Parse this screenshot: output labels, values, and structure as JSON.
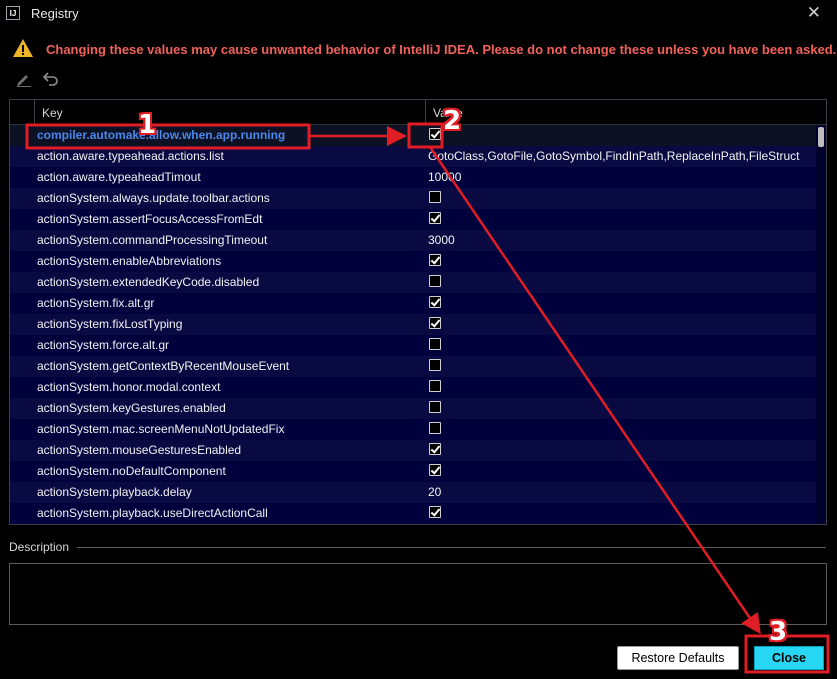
{
  "window": {
    "title": "Registry",
    "app_icon_text": "IJ"
  },
  "warning": {
    "text": "Changing these values may cause unwanted behavior of IntelliJ IDEA. Please do not change these unless you have been asked."
  },
  "table": {
    "headers": {
      "key": "Key",
      "value": "Value"
    },
    "rows": [
      {
        "key": "compiler.automake.allow.when.app.running",
        "type": "bool",
        "checked": true,
        "selected": true
      },
      {
        "key": "action.aware.typeahead.actions.list",
        "type": "text",
        "value": "GotoClass,GotoFile,GotoSymbol,FindInPath,ReplaceInPath,FileStruct"
      },
      {
        "key": "action.aware.typeaheadTimout",
        "type": "text",
        "value": "10000"
      },
      {
        "key": "actionSystem.always.update.toolbar.actions",
        "type": "bool",
        "checked": false
      },
      {
        "key": "actionSystem.assertFocusAccessFromEdt",
        "type": "bool",
        "checked": true
      },
      {
        "key": "actionSystem.commandProcessingTimeout",
        "type": "text",
        "value": "3000"
      },
      {
        "key": "actionSystem.enableAbbreviations",
        "type": "bool",
        "checked": true
      },
      {
        "key": "actionSystem.extendedKeyCode.disabled",
        "type": "bool",
        "checked": false
      },
      {
        "key": "actionSystem.fix.alt.gr",
        "type": "bool",
        "checked": true
      },
      {
        "key": "actionSystem.fixLostTyping",
        "type": "bool",
        "checked": true
      },
      {
        "key": "actionSystem.force.alt.gr",
        "type": "bool",
        "checked": false
      },
      {
        "key": "actionSystem.getContextByRecentMouseEvent",
        "type": "bool",
        "checked": false
      },
      {
        "key": "actionSystem.honor.modal.context",
        "type": "bool",
        "checked": false
      },
      {
        "key": "actionSystem.keyGestures.enabled",
        "type": "bool",
        "checked": false
      },
      {
        "key": "actionSystem.mac.screenMenuNotUpdatedFix",
        "type": "bool",
        "checked": false
      },
      {
        "key": "actionSystem.mouseGesturesEnabled",
        "type": "bool",
        "checked": true
      },
      {
        "key": "actionSystem.noDefaultComponent",
        "type": "bool",
        "checked": true
      },
      {
        "key": "actionSystem.playback.delay",
        "type": "text",
        "value": "20"
      },
      {
        "key": "actionSystem.playback.useDirectActionCall",
        "type": "bool",
        "checked": true
      }
    ]
  },
  "description": {
    "label": "Description"
  },
  "buttons": {
    "restore": "Restore Defaults",
    "close": "Close"
  },
  "annotations": {
    "step1": "1",
    "step2": "2",
    "step3": "3",
    "color": "#e01c24"
  },
  "icons": {
    "warning": "warning-triangle-icon",
    "edit": "pencil-icon",
    "undo": "undo-icon",
    "close": "close-icon"
  },
  "colors": {
    "accent": "#26d6f2",
    "warning_text": "#f0625a",
    "selected_key": "#4a87ea",
    "table_bg": "#00003c"
  }
}
